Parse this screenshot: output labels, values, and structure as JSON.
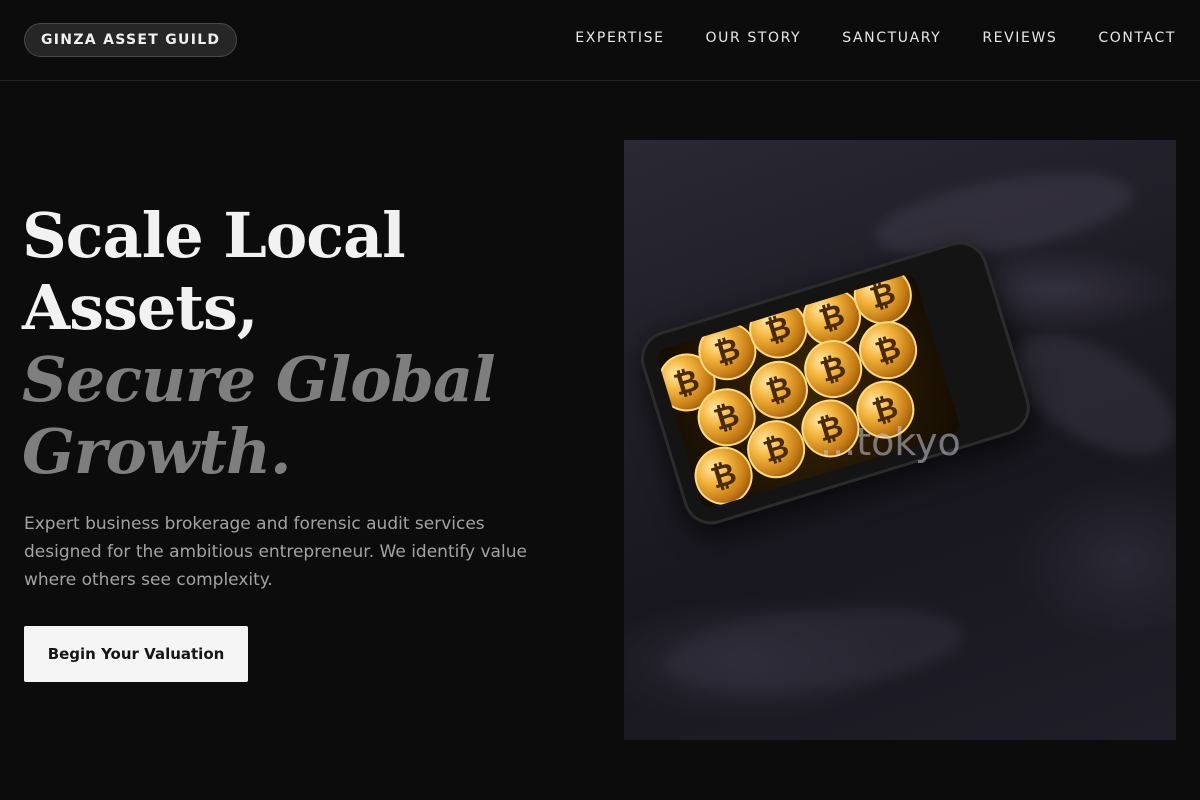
{
  "header": {
    "brand": "GINZA ASSET GUILD",
    "nav": [
      {
        "label": "EXPERTISE"
      },
      {
        "label": "OUR STORY"
      },
      {
        "label": "SANCTUARY"
      },
      {
        "label": "REVIEWS"
      },
      {
        "label": "CONTACT"
      }
    ]
  },
  "hero": {
    "title_line1": "Scale Local",
    "title_line2": "Assets,",
    "title_accent_line1": "Secure Global",
    "title_accent_line2": "Growth.",
    "description": "Expert business brokerage and forensic audit services designed for the ambitious entrepreneur. We identify value where others see complexity.",
    "cta_label": "Begin Your Valuation",
    "image": {
      "coin_symbol": "₿",
      "watermark": "...tokyo"
    }
  },
  "colors": {
    "background": "#0c0c0c",
    "text_primary": "#f2f2f2",
    "text_accent": "#7e7e7e",
    "text_muted": "#a3a3a3",
    "button_bg": "#f5f5f5",
    "button_text": "#161616"
  }
}
